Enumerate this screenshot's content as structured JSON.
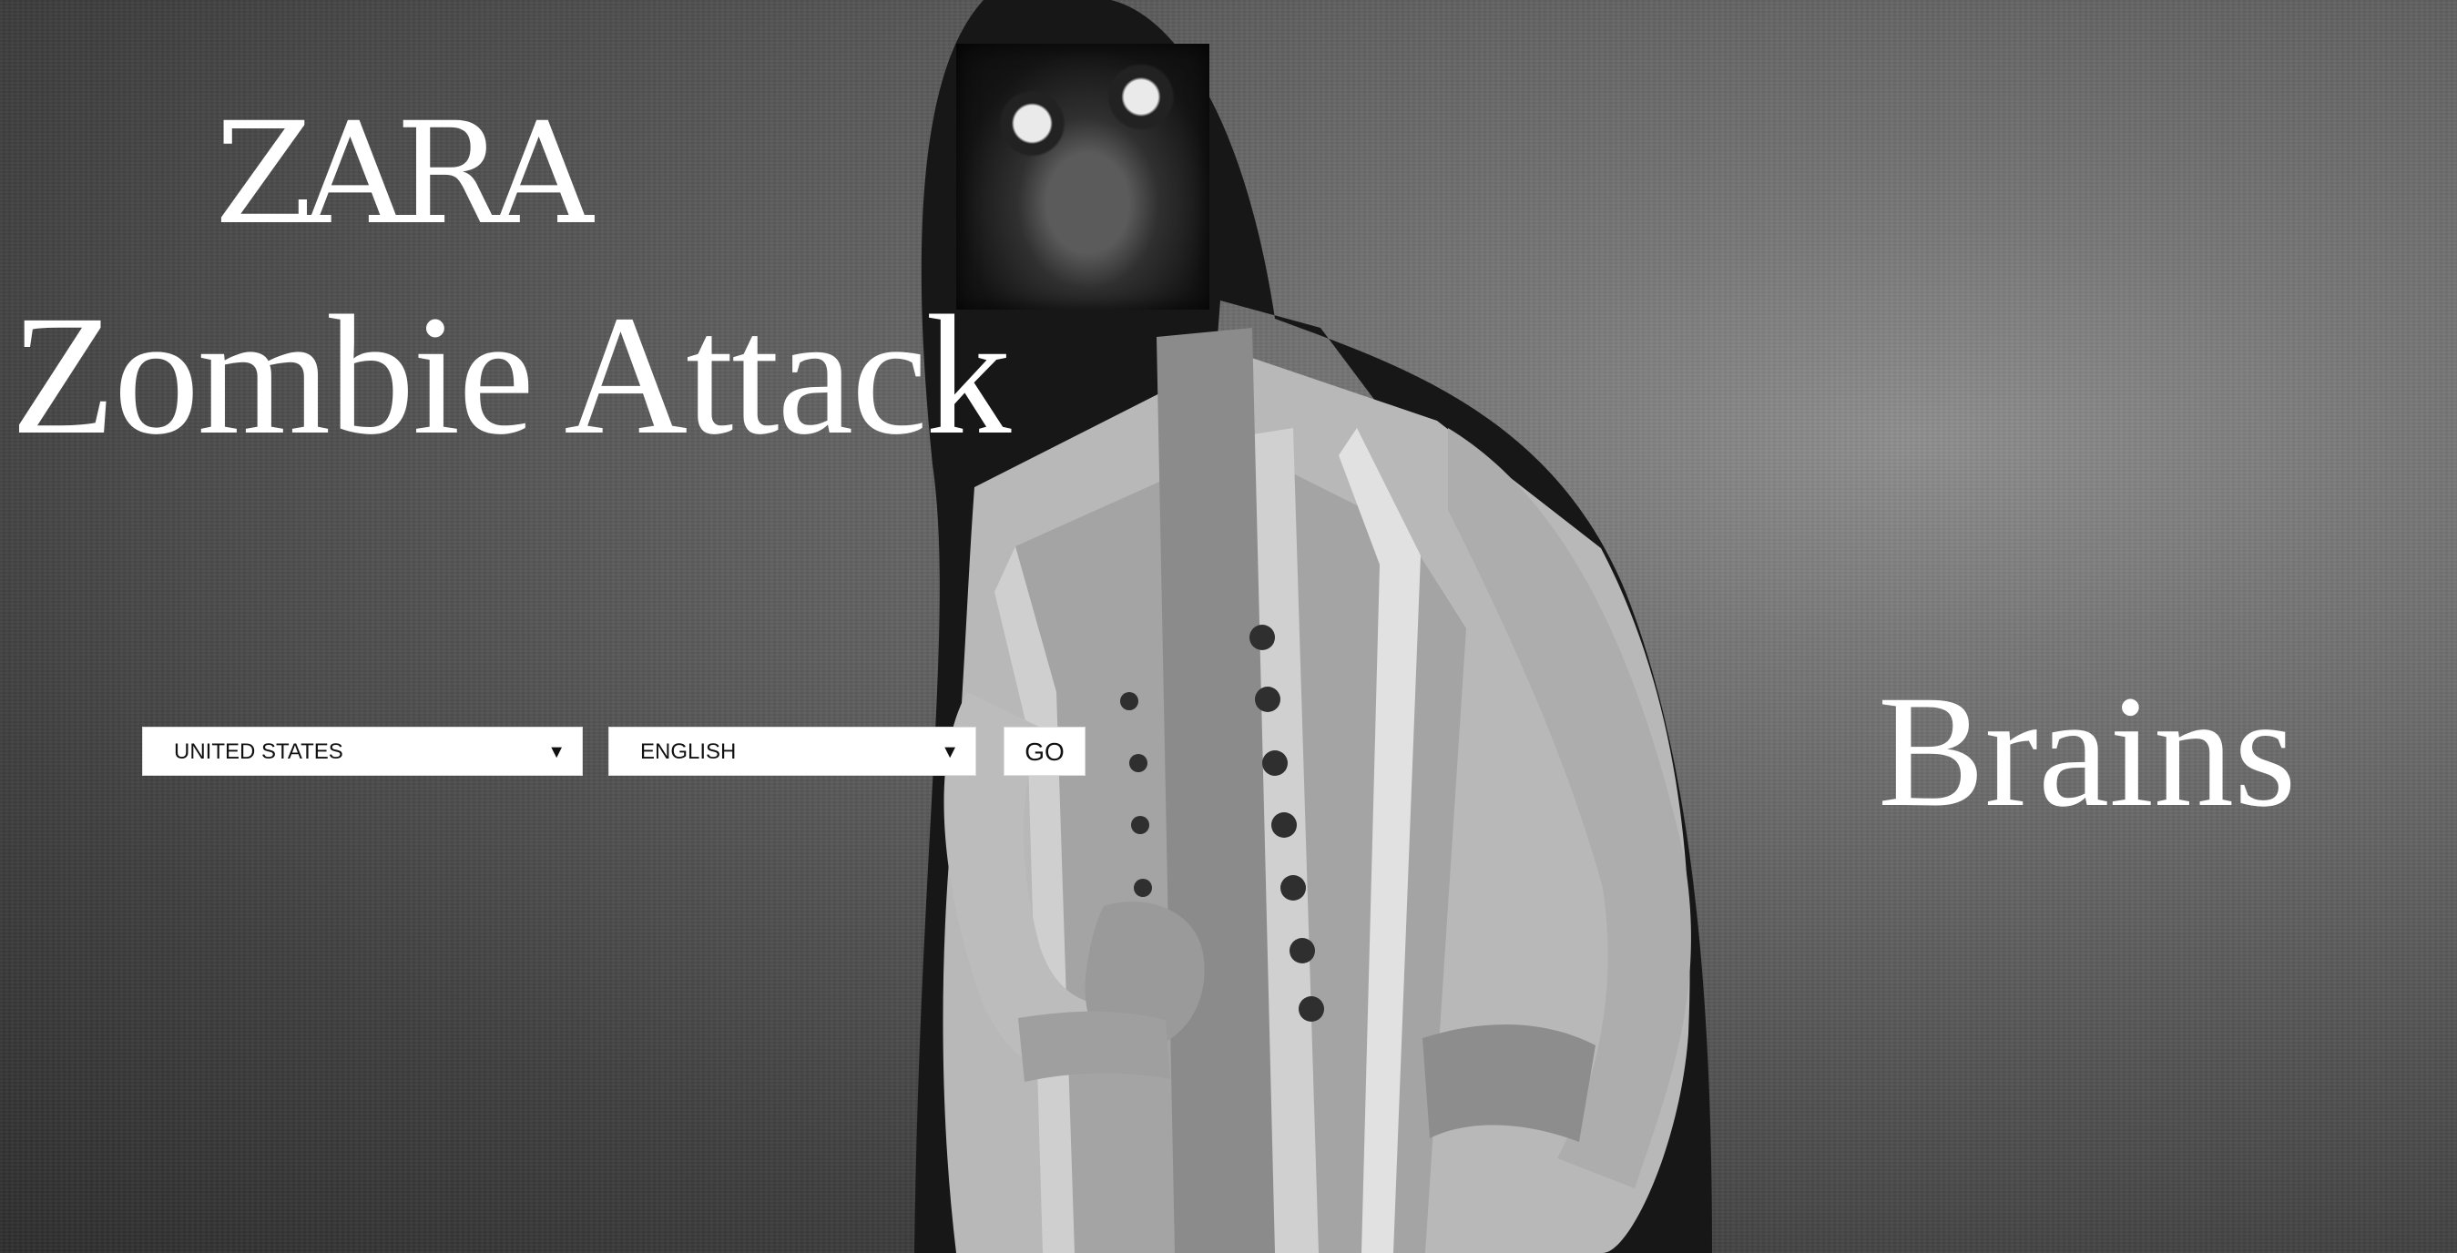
{
  "brand": {
    "logo_text": "ZARA",
    "headline": "Zombie Attack",
    "tagline": "Brains"
  },
  "form": {
    "country": "UNITED STATES",
    "language": "ENGLISH",
    "go_label": "GO"
  },
  "icons": {
    "dropdown_arrow": "▼"
  }
}
